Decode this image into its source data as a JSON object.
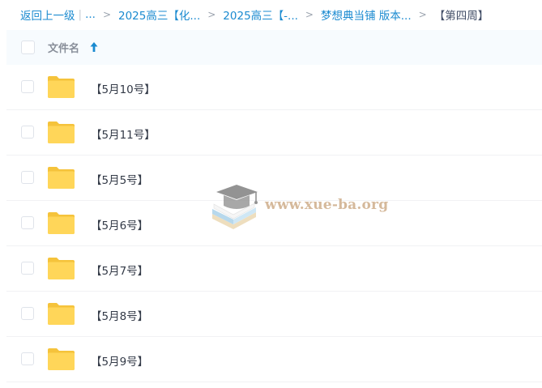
{
  "breadcrumb": {
    "back": "返回上一级",
    "bar": "|",
    "ellipsis": "...",
    "sep": ">",
    "items": [
      "2025高三【化...",
      "2025高三【-...",
      "梦想典当铺 版本..."
    ],
    "current": "【第四周】"
  },
  "list_header": {
    "name_label": "文件名",
    "sort_icon": "arrow-up-icon"
  },
  "files": [
    {
      "name": "【5月10号】",
      "icon": "folder-icon"
    },
    {
      "name": "【5月11号】",
      "icon": "folder-icon"
    },
    {
      "name": "【5月5号】",
      "icon": "folder-icon"
    },
    {
      "name": "【5月6号】",
      "icon": "folder-icon"
    },
    {
      "name": "【5月7号】",
      "icon": "folder-icon"
    },
    {
      "name": "【5月8号】",
      "icon": "folder-icon"
    },
    {
      "name": "【5月9号】",
      "icon": "folder-icon"
    }
  ],
  "watermark": {
    "text": "www.xue-ba.org"
  },
  "colors": {
    "link": "#1a8ad0",
    "folder": "#ffd659",
    "header_bg": "#f7fbfe",
    "watermark": "#c8a27a"
  }
}
